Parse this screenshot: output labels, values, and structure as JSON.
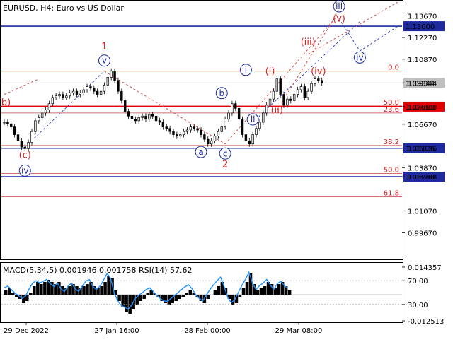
{
  "chart_data": [
    {
      "type": "line",
      "subtype": "candlestick",
      "title": "EURUSD, H4:  Euro vs US Dollar",
      "ylim": [
        0.98,
        1.146
      ],
      "x_ticks": [
        "29 Dec 2022",
        "27 Jan 16:00",
        "28 Feb 00:00",
        "29 Mar 08:00"
      ],
      "y_ticks": [
        1.1367,
        1.1227,
        1.1087,
        1.09344,
        1.07809,
        1.0667,
        1.05126,
        1.0387,
        1.03288,
        1.0107,
        0.9967
      ],
      "series": [
        {
          "name": "",
          "values": [
            1.068,
            1.067,
            1.065,
            1.06,
            1.056,
            1.052,
            1.051,
            1.055,
            1.062,
            1.069,
            1.071,
            1.074,
            1.076,
            1.08,
            1.084,
            1.085,
            1.086,
            1.084,
            1.085,
            1.087,
            1.088,
            1.086,
            1.087,
            1.089,
            1.091,
            1.09,
            1.088,
            1.086,
            1.088,
            1.092,
            1.097,
            1.101,
            1.095,
            1.088,
            1.082,
            1.075,
            1.072,
            1.07,
            1.069,
            1.071,
            1.072,
            1.07,
            1.073,
            1.072,
            1.069,
            1.068,
            1.065,
            1.064,
            1.062,
            1.06,
            1.059,
            1.06,
            1.062,
            1.063,
            1.065,
            1.064,
            1.063,
            1.06,
            1.057,
            1.054,
            1.056,
            1.059,
            1.062,
            1.065,
            1.07,
            1.074,
            1.08,
            1.077,
            1.07,
            1.06,
            1.056,
            1.054,
            1.06,
            1.064,
            1.068,
            1.074,
            1.079,
            1.083,
            1.088,
            1.096,
            1.086,
            1.079,
            1.083,
            1.082,
            1.086,
            1.089,
            1.091,
            1.084,
            1.088,
            1.093,
            1.096,
            1.095,
            1.0934
          ]
        }
      ],
      "horizontal_levels": [
        {
          "value": 1.13,
          "label": "1.13000",
          "style": "blue"
        },
        {
          "value": 1.09344,
          "label": "1.09344",
          "style": "current"
        },
        {
          "value": 1.07809,
          "label": "1.07809",
          "style": "red"
        },
        {
          "value": 1.05126,
          "label": "1.05126",
          "style": "blue"
        },
        {
          "value": 1.03288,
          "label": "1.03288",
          "style": "blue"
        }
      ],
      "fib_levels": [
        {
          "value": 1.101,
          "label": "0.0"
        },
        {
          "value": 1.0785,
          "label": "50.0"
        },
        {
          "value": 1.074,
          "label": "23.6"
        },
        {
          "value": 1.053,
          "label": "38.2"
        },
        {
          "value": 1.035,
          "label": "50.0"
        },
        {
          "value": 1.02,
          "label": "61.8"
        }
      ],
      "wave_labels": [
        {
          "text": "1",
          "color": "red",
          "x_index": 29,
          "y": 1.115
        },
        {
          "text": "v",
          "color": "blue",
          "x_index": 29,
          "y": 1.106
        },
        {
          "text": "(b)",
          "color": "red",
          "x_index": 0,
          "y": 1.079
        },
        {
          "text": "(c)",
          "color": "red",
          "x_index": 6,
          "y": 1.045
        },
        {
          "text": "iv",
          "color": "blue",
          "x_index": 6,
          "y": 1.035
        },
        {
          "text": "b",
          "color": "blue",
          "x_index": 63,
          "y": 1.085
        },
        {
          "text": "a",
          "color": "blue",
          "x_index": 57,
          "y": 1.047
        },
        {
          "text": "c",
          "color": "blue",
          "x_index": 64,
          "y": 1.046
        },
        {
          "text": "2",
          "color": "red",
          "x_index": 64,
          "y": 1.039
        },
        {
          "text": "i",
          "color": "blue",
          "x_index": 70,
          "y": 1.1
        },
        {
          "text": "ii",
          "color": "blue",
          "x_index": 72,
          "y": 1.068
        },
        {
          "text": "(i)",
          "color": "red",
          "x_index": 77,
          "y": 1.099
        },
        {
          "text": "(ii)",
          "color": "red",
          "x_index": 79,
          "y": 1.074
        }
      ],
      "forecast_labels": [
        {
          "text": "(iii)",
          "color": "red",
          "x_index": 88,
          "y": 1.118
        },
        {
          "text": "iii",
          "color": "blue",
          "x_index": 97,
          "y": 1.141
        },
        {
          "text": "(v)",
          "color": "red",
          "x_index": 97,
          "y": 1.133
        },
        {
          "text": "(iv)",
          "color": "red",
          "x_index": 91,
          "y": 1.099
        },
        {
          "text": "iv",
          "color": "blue",
          "x_index": 103,
          "y": 1.108
        }
      ],
      "x_count": 115
    },
    {
      "type": "bar",
      "title": "MACD(5,34,5) 0.001946 0.001758 RSI(14) 57.62",
      "ylim": [
        -0.013,
        0.015
      ],
      "y_ticks": [
        "0.014357",
        "70.00",
        "30.00",
        "-0.012513"
      ],
      "series": [
        {
          "name": "",
          "values": [
            0.002,
            0.003,
            0.001,
            -0.001,
            -0.002,
            -0.004,
            -0.003,
            0.001,
            0.004,
            0.006,
            0.005,
            0.006,
            0.007,
            0.006,
            0.005,
            0.006,
            0.004,
            0.003,
            0.004,
            0.005,
            0.004,
            0.003,
            0.004,
            0.005,
            0.006,
            0.004,
            0.003,
            0.004,
            0.006,
            0.009,
            0.008,
            0.002,
            -0.003,
            -0.006,
            -0.008,
            -0.009,
            -0.007,
            -0.005,
            -0.003,
            -0.002,
            0.001,
            0.002,
            0.001,
            -0.001,
            -0.003,
            -0.004,
            -0.005,
            -0.004,
            -0.003,
            -0.002,
            -0.001,
            0.001,
            0.002,
            0.001,
            -0.001,
            -0.003,
            -0.004,
            -0.002,
            0.0,
            0.002,
            0.004,
            0.006,
            0.003,
            -0.002,
            -0.005,
            -0.004,
            -0.001,
            0.003,
            0.006,
            0.01,
            0.005,
            0.002,
            0.003,
            0.004,
            0.006,
            0.005,
            0.003,
            0.005,
            0.006,
            0.004,
            0.002
          ]
        }
      ],
      "rsi_values": [
        58,
        61,
        55,
        49,
        45,
        40,
        44,
        56,
        66,
        70,
        66,
        69,
        72,
        65,
        60,
        66,
        56,
        52,
        61,
        66,
        56,
        52,
        61,
        69,
        72,
        60,
        55,
        61,
        71,
        82,
        74,
        50,
        36,
        28,
        25,
        22,
        30,
        40,
        46,
        50,
        55,
        58,
        52,
        45,
        40,
        36,
        35,
        40,
        45,
        50,
        55,
        60,
        63,
        56,
        46,
        40,
        36,
        46,
        55,
        63,
        70,
        76,
        60,
        42,
        33,
        38,
        50,
        62,
        72,
        84,
        66,
        55,
        62,
        66,
        72,
        63,
        55,
        65,
        69,
        61,
        57.6
      ]
    }
  ]
}
